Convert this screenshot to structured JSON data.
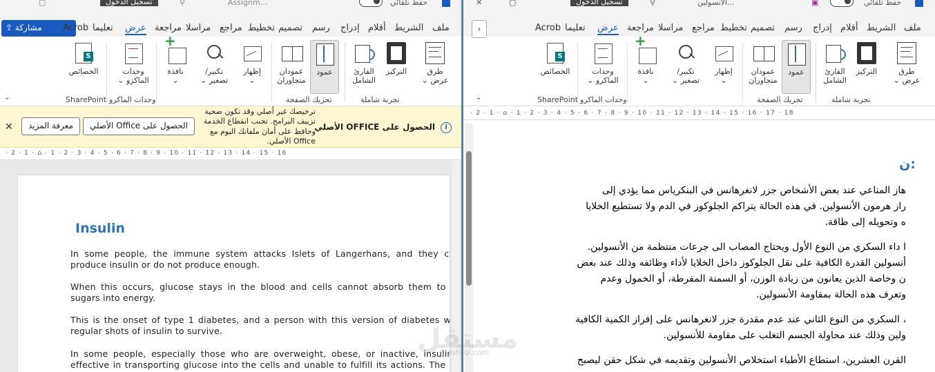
{
  "left": {
    "titlebar": {
      "autosave": "حفظ تلقائي",
      "docname": "Assignm...",
      "signin": "تسجيل الدخول"
    },
    "share_label": "مشاركة",
    "tabs": [
      "ملف",
      "الشريط",
      "أقلام",
      "إدراج",
      "رسم",
      "تصميم",
      "تخطيط",
      "مراجع",
      "مراسلا",
      "مراجعة",
      "عرض",
      "تعليما",
      "Acrob"
    ],
    "active_tab": "عرض",
    "ribbon": {
      "buttons": [
        "طرق\nعرض ⌄",
        "التركيز",
        "القارئ\nالشامل",
        "عمود",
        "عمودان\nمتجاوران",
        "إظهار\n⌄",
        "تكبير/\nتصغير ⌄",
        "نافذة\n⌄",
        "وحدات\nالماكرو ⌄",
        "الخصائص"
      ],
      "groups": [
        "تجربة شاملة",
        "تحريك الصفحة",
        "وحدات الماكرو",
        "SharePoint"
      ]
    },
    "message_bar": {
      "title": "الحصول على OFFICE الأصلي",
      "body": "ترخيصك غير أصلي وقد تكون ضحية تزييف البرامج. تجنب انقطاع الخدمة وحافظ على أمان ملفاتك اليوم مع Office الأصلي.",
      "get_button": "الحصول على Office الأصلي",
      "learn_button": "معرفة المزيد"
    },
    "ruler": "· 2 · 1 · ⌂ · 1 · 2 · 3 · 4 · 5 · 6 · 7 · 8 · 9 · 10 · 11 · 12 · 13 · 14 · 15 · 16",
    "document": {
      "title": "Insulin",
      "paragraphs": [
        "In some people, the immune system attacks Islets of Langerhans, and they cease to produce insulin or do not produce enough.",
        "When this occurs, glucose stays in the blood and cells cannot absorb them to convert sugars into energy.",
        "This is the onset of type 1 diabetes, and a person with this version of diabetes will need regular shots of insulin to survive.",
        "In some people, especially those who are overweight, obese, or inactive, insulin is not effective in transporting glucose into the cells and unable to fulfill its actions. The inability of"
      ]
    }
  },
  "right": {
    "titlebar": {
      "autosave": "حفظ تلقائي",
      "docname": "الأنسولين...",
      "signin": "تسجيل الدخول"
    },
    "tabs": [
      "ملف",
      "الشريط",
      "أقلام",
      "إدراج",
      "رسم",
      "تصميم",
      "تخطيط",
      "مراجع",
      "مراسلا",
      "مراجعة",
      "عرض",
      "تعليما",
      "Acrob"
    ],
    "active_tab": "عرض",
    "ribbon": {
      "buttons": [
        "طرق\nعرض ⌄",
        "التركيز",
        "القارئ\nالشامل",
        "عمود",
        "عمودان\nمتجاوران",
        "إظهار\n⌄",
        "تكبير/\nتصغير ⌄",
        "نافذة\n⌄",
        "وحدات\nالماكرو ⌄",
        "الخصائص"
      ],
      "groups": [
        "تجربة شاملة",
        "تحريك الصفحة",
        "وحدات الماكرو",
        "SharePoint"
      ]
    },
    "ruler": "· 2 · 1 · ⌂ · 1 · 2 · 3 · 4 · 5 · 6 · 7 · 8 · 9 · 10 · 11 · 12 · 13 · 14 · 15 · 16 · 17 · 18",
    "document": {
      "title": "ن:",
      "lines": [
        "هاز المناعي عند بعض الأشخاص جزر لانغرهانس في البنكرياس مما يؤدي إلى",
        "راز هرمون الأنسولين. في هذه الحالة يتراكم الجلوكوز في الدم ولا تستطيع الخلايا",
        "ه وتحويله إلى طاقة.",
        "ا داء السكري من النوع الأول ويحتاج المصاب الى جرعات منتظمة من الأنسولين.",
        "أنسولين القدرة الكافية على نقل الجلوكوز داخل الخلايا لأداء وظائفه وذلك عند بعض",
        "ن وخاصة الذين يعانون من زيادة الوزن، أو السمنة المفرطة، أو الخمول وعدم",
        "وتعرف هذه الحالة بمقاومة الأنسولين.",
        "، السكري من النوع الثاني عند عدم مقدرة جزر لانغرهانس على إفراز الكمية الكافية",
        "ولين وذلك عند محاولة الجسم التغلب على مقاومة للأنسولين.",
        "القرن العشرين، استطاع الأطباء استخلاص الأنسولين وتقديمه في شكل حقن ليصبح"
      ]
    },
    "watermark": "مستقل",
    "watermark_sub": "mostaql.com"
  },
  "colors": {
    "accent": "#185abd",
    "title": "#2e74b5",
    "banner": "#fdf6d3"
  }
}
